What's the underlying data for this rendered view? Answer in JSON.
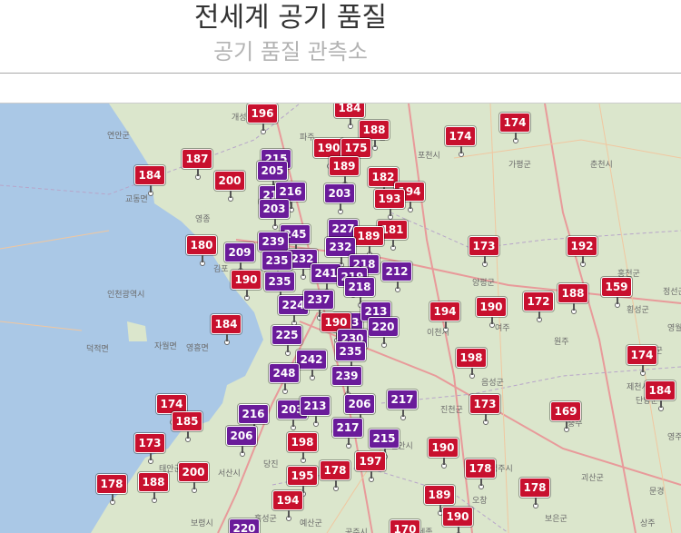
{
  "header": {
    "title": "전세계 공기 품질",
    "subtitle": "공기 품질 관측소"
  },
  "colors": {
    "unhealthy": "#c8102e",
    "very_unhealthy": "#6a1b9a",
    "sea": "#aac8e6",
    "land": "#dbe6cc"
  },
  "places": [
    "개성시",
    "연안군",
    "교동면",
    "강화군",
    "영종",
    "인천광역시",
    "덕적면",
    "자월면",
    "영흥면",
    "파주",
    "김포",
    "동두천",
    "포천시",
    "가평군",
    "양평군",
    "이천시",
    "여주",
    "원주",
    "홍천군",
    "춘천시",
    "횡성군",
    "평창군",
    "제천시",
    "충주",
    "음성군",
    "진천군",
    "천안시",
    "아산시",
    "당진",
    "서산시",
    "태안군",
    "홍성군",
    "예산군",
    "보령시",
    "청양군",
    "공주시",
    "세종",
    "오창",
    "청주시",
    "괴산군",
    "보은군",
    "상주",
    "문경",
    "영주",
    "단양군",
    "영월",
    "정선군"
  ],
  "markers": [
    {
      "value": "196",
      "level": "red"
    },
    {
      "value": "184",
      "level": "red"
    },
    {
      "value": "188",
      "level": "red"
    },
    {
      "value": "174",
      "level": "red"
    },
    {
      "value": "174",
      "level": "red"
    },
    {
      "value": "190",
      "level": "red"
    },
    {
      "value": "175",
      "level": "red"
    },
    {
      "value": "215",
      "level": "purple"
    },
    {
      "value": "187",
      "level": "red"
    },
    {
      "value": "184",
      "level": "red"
    },
    {
      "value": "205",
      "level": "purple"
    },
    {
      "value": "200",
      "level": "red"
    },
    {
      "value": "189",
      "level": "red"
    },
    {
      "value": "182",
      "level": "red"
    },
    {
      "value": "203",
      "level": "purple"
    },
    {
      "value": "216",
      "level": "purple"
    },
    {
      "value": "216",
      "level": "purple"
    },
    {
      "value": "194",
      "level": "red"
    },
    {
      "value": "193",
      "level": "red"
    },
    {
      "value": "203",
      "level": "purple"
    },
    {
      "value": "181",
      "level": "red"
    },
    {
      "value": "245",
      "level": "purple"
    },
    {
      "value": "227",
      "level": "purple"
    },
    {
      "value": "239",
      "level": "purple"
    },
    {
      "value": "189",
      "level": "red"
    },
    {
      "value": "180",
      "level": "red"
    },
    {
      "value": "173",
      "level": "red"
    },
    {
      "value": "192",
      "level": "red"
    },
    {
      "value": "209",
      "level": "purple"
    },
    {
      "value": "232",
      "level": "purple"
    },
    {
      "value": "232",
      "level": "purple"
    },
    {
      "value": "235",
      "level": "purple"
    },
    {
      "value": "218",
      "level": "purple"
    },
    {
      "value": "212",
      "level": "purple"
    },
    {
      "value": "241",
      "level": "purple"
    },
    {
      "value": "190",
      "level": "red"
    },
    {
      "value": "235",
      "level": "purple"
    },
    {
      "value": "219",
      "level": "purple"
    },
    {
      "value": "218",
      "level": "purple"
    },
    {
      "value": "188",
      "level": "red"
    },
    {
      "value": "159",
      "level": "red"
    },
    {
      "value": "224",
      "level": "purple"
    },
    {
      "value": "237",
      "level": "purple"
    },
    {
      "value": "172",
      "level": "red"
    },
    {
      "value": "190",
      "level": "red"
    },
    {
      "value": "194",
      "level": "red"
    },
    {
      "value": "223",
      "level": "purple"
    },
    {
      "value": "213",
      "level": "purple"
    },
    {
      "value": "220",
      "level": "purple"
    },
    {
      "value": "190",
      "level": "red"
    },
    {
      "value": "184",
      "level": "red"
    },
    {
      "value": "225",
      "level": "purple"
    },
    {
      "value": "230",
      "level": "purple"
    },
    {
      "value": "235",
      "level": "purple"
    },
    {
      "value": "198",
      "level": "red"
    },
    {
      "value": "174",
      "level": "red"
    },
    {
      "value": "242",
      "level": "purple"
    },
    {
      "value": "248",
      "level": "purple"
    },
    {
      "value": "239",
      "level": "purple"
    },
    {
      "value": "184",
      "level": "red"
    },
    {
      "value": "174",
      "level": "red"
    },
    {
      "value": "203",
      "level": "purple"
    },
    {
      "value": "213",
      "level": "purple"
    },
    {
      "value": "206",
      "level": "purple"
    },
    {
      "value": "217",
      "level": "purple"
    },
    {
      "value": "173",
      "level": "red"
    },
    {
      "value": "185",
      "level": "red"
    },
    {
      "value": "216",
      "level": "purple"
    },
    {
      "value": "169",
      "level": "red"
    },
    {
      "value": "217",
      "level": "purple"
    },
    {
      "value": "206",
      "level": "purple"
    },
    {
      "value": "173",
      "level": "red"
    },
    {
      "value": "198",
      "level": "red"
    },
    {
      "value": "215",
      "level": "purple"
    },
    {
      "value": "190",
      "level": "red"
    },
    {
      "value": "197",
      "level": "red"
    },
    {
      "value": "178",
      "level": "red"
    },
    {
      "value": "178",
      "level": "red"
    },
    {
      "value": "188",
      "level": "red"
    },
    {
      "value": "200",
      "level": "red"
    },
    {
      "value": "195",
      "level": "red"
    },
    {
      "value": "178",
      "level": "red"
    },
    {
      "value": "178",
      "level": "red"
    },
    {
      "value": "194",
      "level": "red"
    },
    {
      "value": "189",
      "level": "red"
    },
    {
      "value": "220",
      "level": "purple"
    },
    {
      "value": "170",
      "level": "red"
    },
    {
      "value": "190",
      "level": "red"
    }
  ]
}
